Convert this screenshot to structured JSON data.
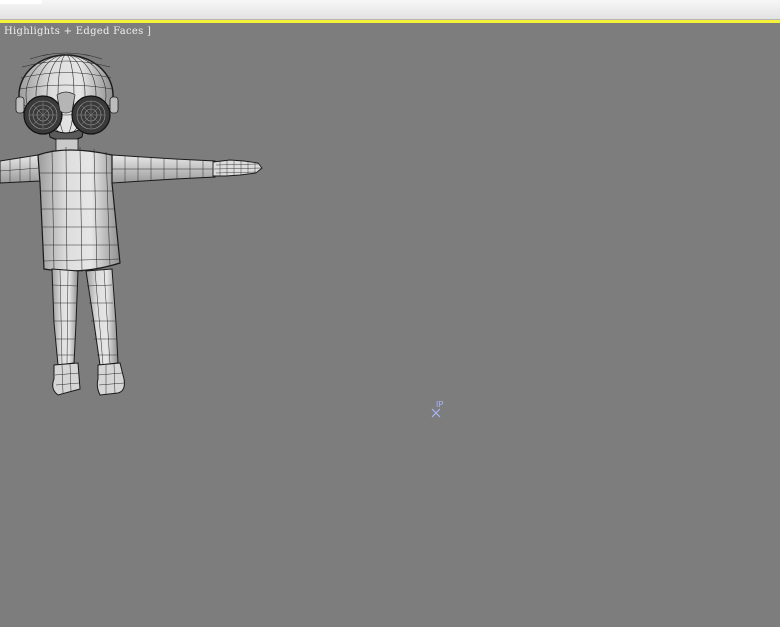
{
  "window": {
    "title": ""
  },
  "viewport": {
    "label": "Highlights + Edged Faces ]",
    "background_color": "#7d7d7d",
    "active_border_color": "#f6f23a"
  },
  "model": {
    "icon": "wireframe-character-model-icon"
  },
  "pivot": {
    "label": "IP",
    "icon": "pivot-gizmo-icon",
    "color": "#aab8ff"
  }
}
